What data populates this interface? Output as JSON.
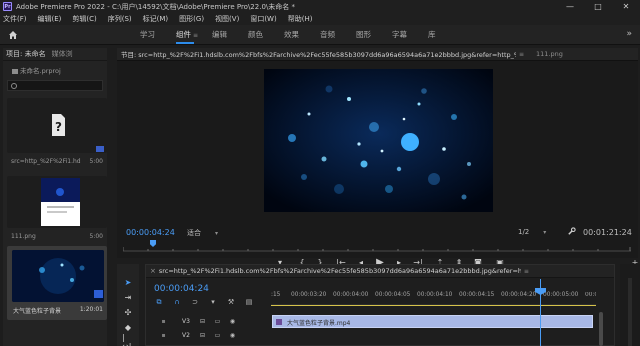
{
  "window": {
    "title": "Adobe Premiere Pro 2022 - C:\\用户\\14592\\文档\\Adobe\\Premiere Pro\\22.0\\未命名 *",
    "controls": [
      "—",
      "□",
      "✕"
    ]
  },
  "menu": [
    "文件(F)",
    "编辑(E)",
    "剪辑(C)",
    "序列(S)",
    "标记(M)",
    "图形(G)",
    "视图(V)",
    "窗口(W)",
    "帮助(H)"
  ],
  "workspace": {
    "tabs": [
      "学习",
      "组件",
      "编辑",
      "颜色",
      "效果",
      "音频",
      "图形",
      "字幕",
      "库"
    ],
    "active": "组件",
    "overflow": "»"
  },
  "project": {
    "tab_project": "项目: 未命名",
    "tab_media": "媒体浏",
    "file": "未命名.prproj",
    "items": [
      {
        "name": "src=http_%2F%2Fi1.hdslb.com",
        "duration": "5:00"
      },
      {
        "name": "111.png",
        "duration": "5:00"
      },
      {
        "name": "大气蓝色粒子背景",
        "duration": "1:20:01"
      }
    ]
  },
  "program": {
    "tab_main": "节目: src=http_%2F%2Fi1.hdslb.com%2Fbfs%2Farchive%2Fec55fe585b3097dd6a96a6594a6a71e2bbbd.jpg&refer=http_%2F%2Fi1...",
    "tab_menu": "≡",
    "tab_secondary": "111.png",
    "timecode_left": "00:00:04:24",
    "fit": "适合",
    "resolution": "1/2",
    "timecode_right": "00:01:21:24"
  },
  "timeline": {
    "close": "×",
    "tab": "src=http_%2F%2Fi1.hdslb.com%2Fbfs%2Farchive%2Fec55fe585b3097dd6a96a6594a6a71e2bbbd.jpg&refer=http_%2F%2Fi1.hdslb.com",
    "tab_menu": "≡",
    "timecode": "00:00:04:24",
    "ruler": [
      ":15",
      "00:00:03:20",
      "00:00:04:00",
      "00:00:04:05",
      "00:00:04:10",
      "00:00:04:15",
      "00:00:04:20",
      "00:00:05:00",
      "00:00:05:"
    ],
    "tracks": [
      "V3",
      "V2",
      "V1"
    ],
    "clip_name": "大气蓝色粒子背景.mp4"
  },
  "colors": {
    "accent": "#2d8ceb",
    "timecode": "#4a9cf5",
    "clip": "#a8b8e6"
  }
}
